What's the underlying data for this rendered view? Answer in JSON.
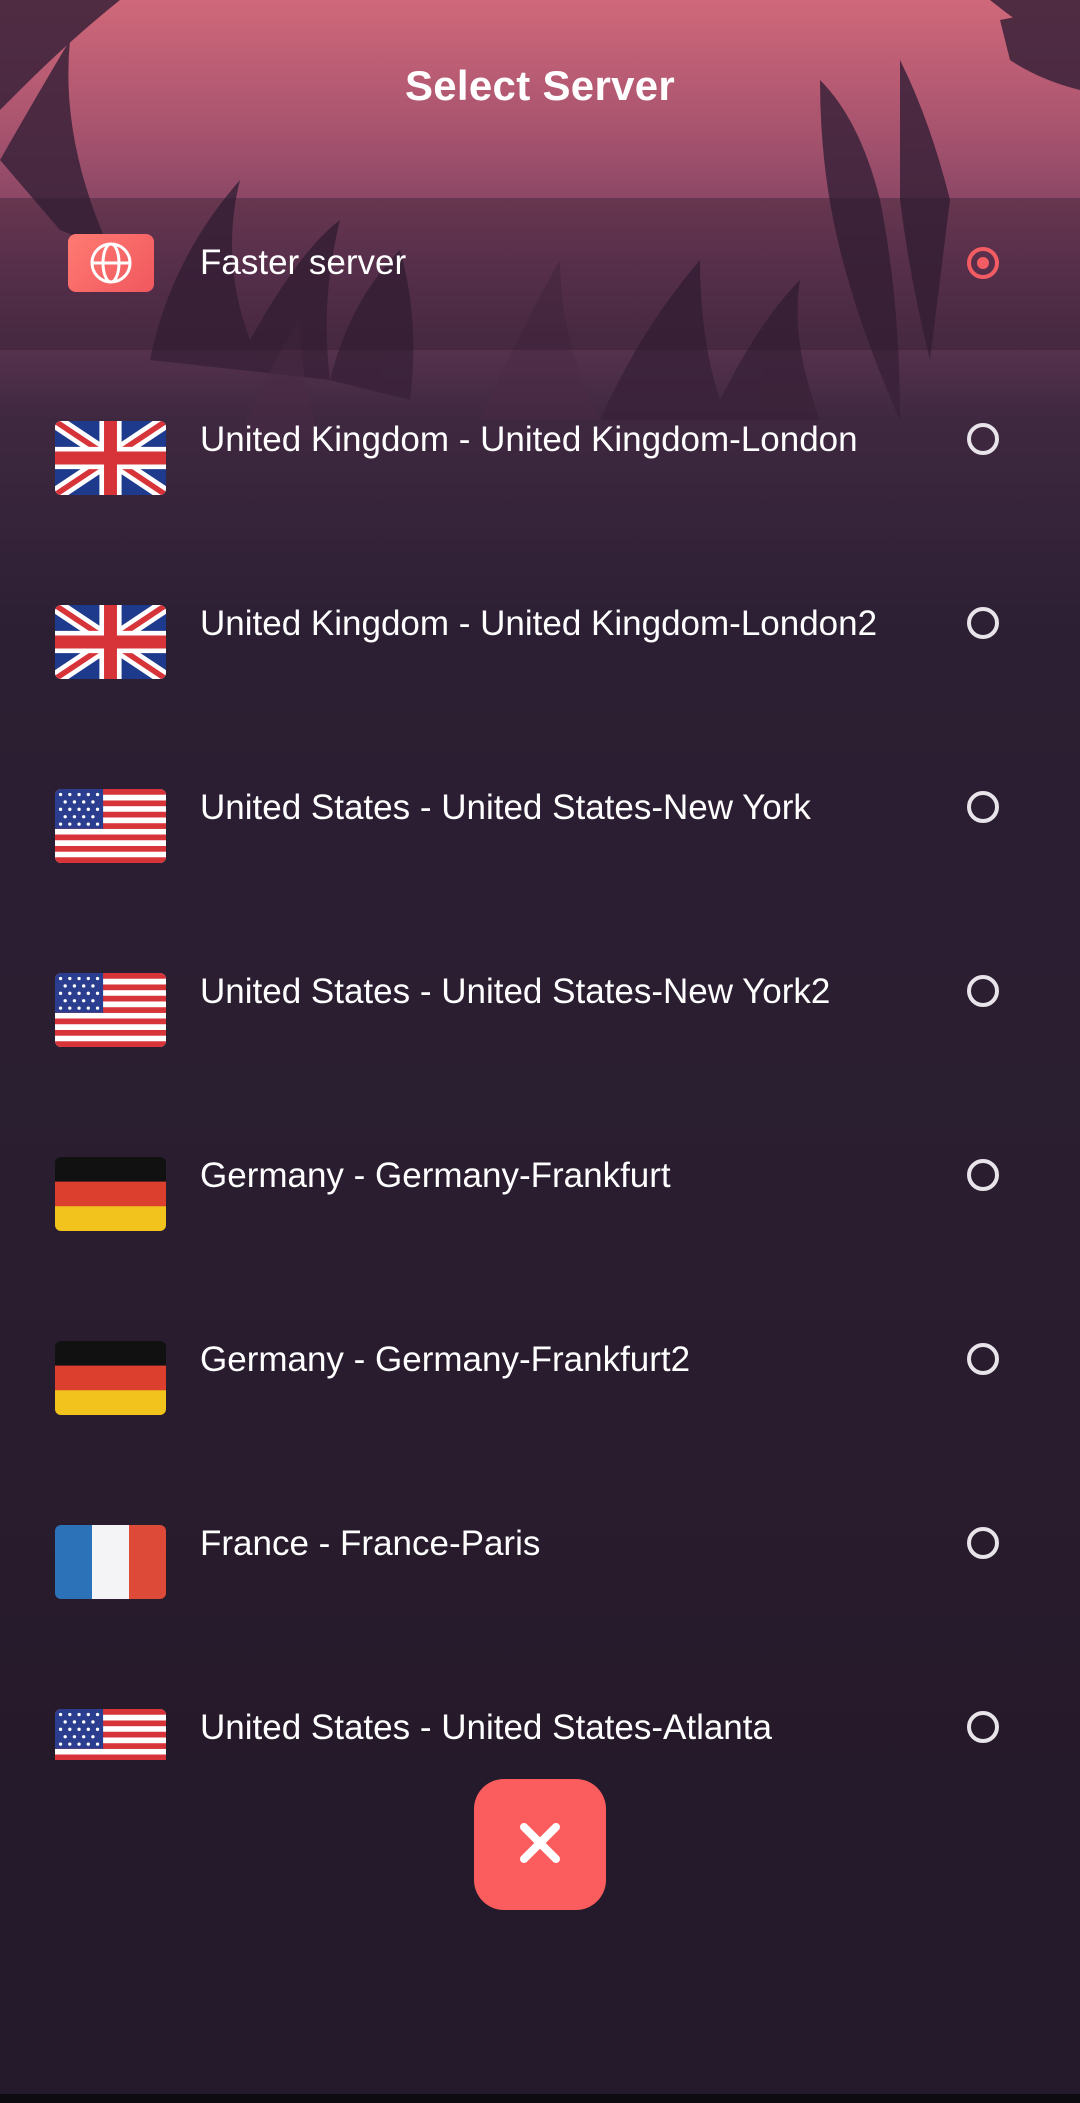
{
  "header": {
    "title": "Select Server"
  },
  "servers": [
    {
      "label": "Faster server",
      "flag": "globe-icon",
      "selected": true
    },
    {
      "label": "United Kingdom - United Kingdom-London",
      "flag": "uk-flag-icon",
      "selected": false
    },
    {
      "label": "United Kingdom - United Kingdom-London2",
      "flag": "uk-flag-icon",
      "selected": false
    },
    {
      "label": "United States - United States-New York",
      "flag": "us-flag-icon",
      "selected": false
    },
    {
      "label": "United States - United States-New York2",
      "flag": "us-flag-icon",
      "selected": false
    },
    {
      "label": "Germany - Germany-Frankfurt",
      "flag": "germany-flag-icon",
      "selected": false
    },
    {
      "label": "Germany - Germany-Frankfurt2",
      "flag": "germany-flag-icon",
      "selected": false
    },
    {
      "label": "France - France-Paris",
      "flag": "france-flag-icon",
      "selected": false
    },
    {
      "label": "United States - United States-Atlanta",
      "flag": "us-flag-icon",
      "selected": false
    }
  ],
  "close_button": {
    "icon": "close-icon"
  },
  "colors": {
    "accent": "#fb5d5f",
    "background": "#2a1d30"
  }
}
